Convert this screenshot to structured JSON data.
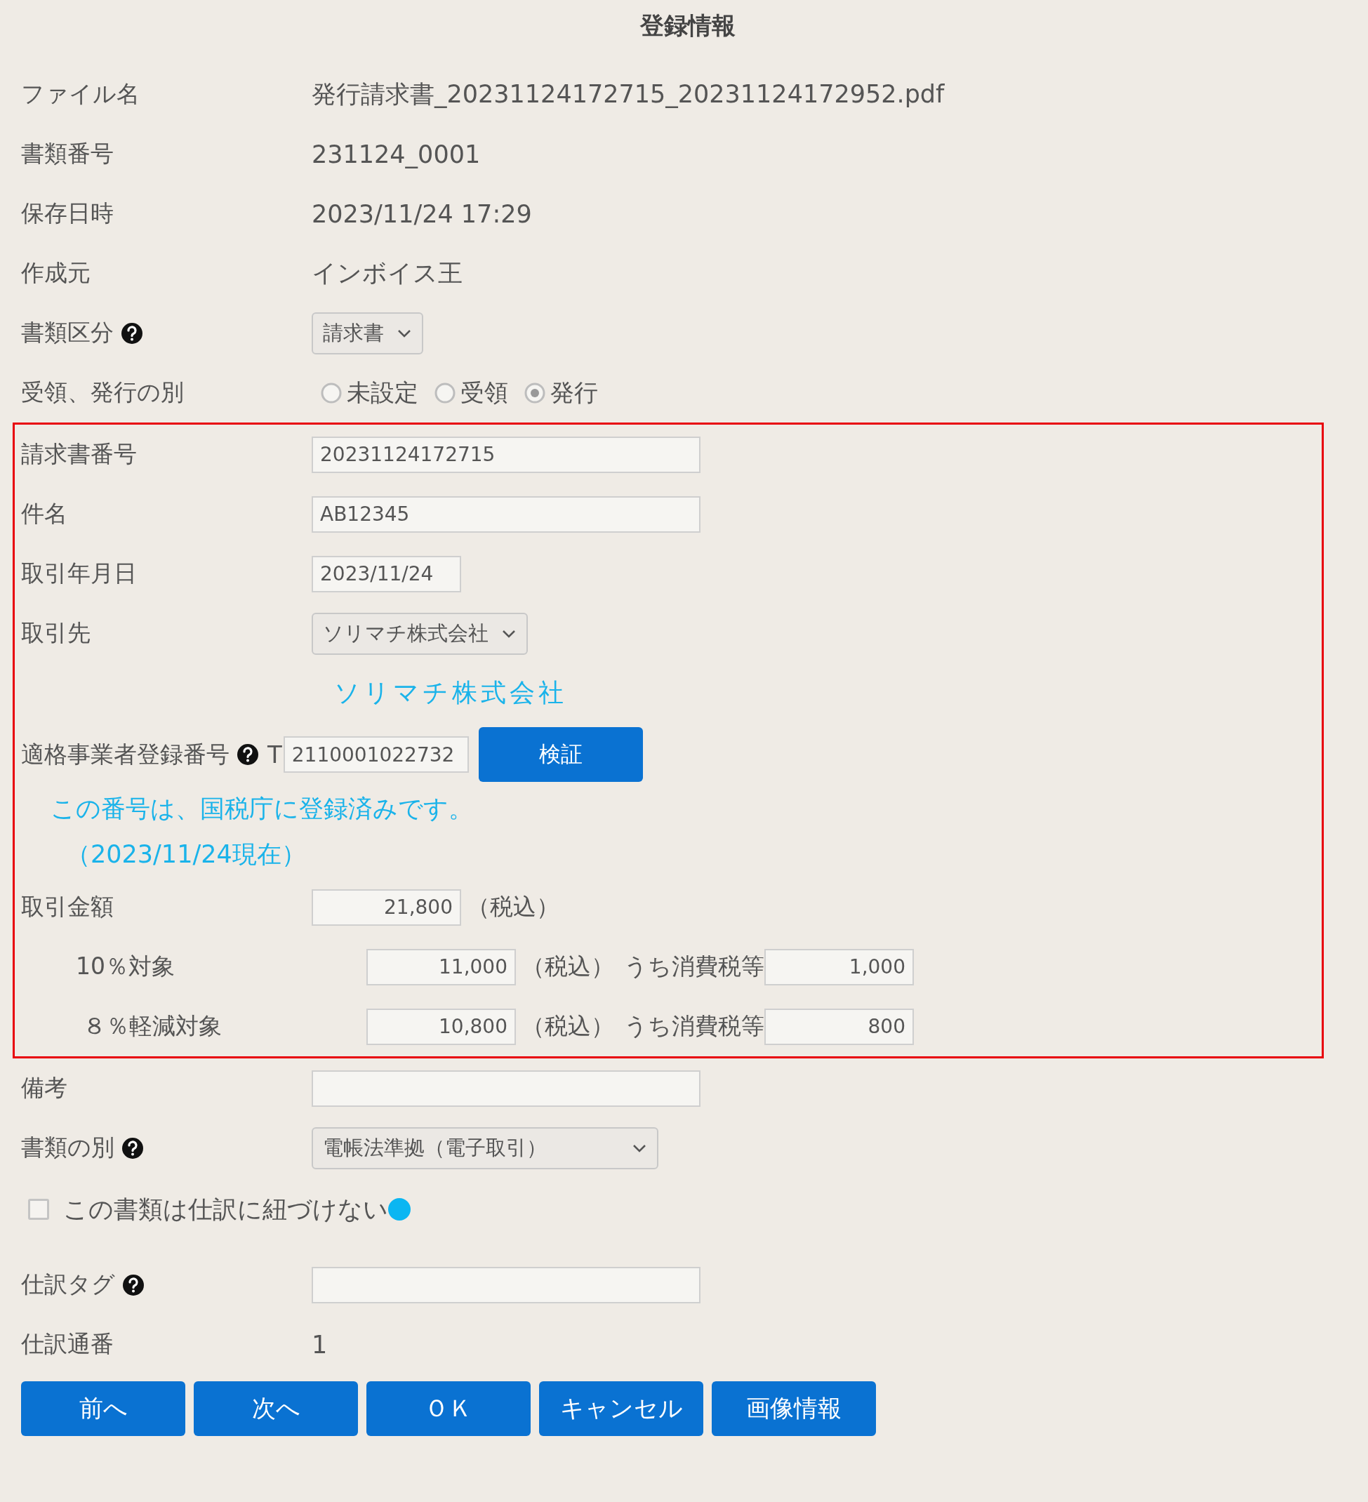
{
  "title": "登録情報",
  "fields": [
    {
      "kind": "text",
      "label": "ファイル名",
      "value": "発行請求書_20231124172715_20231124172952.pdf"
    },
    {
      "kind": "text",
      "label": "書類番号",
      "value": "231124_0001"
    },
    {
      "kind": "text",
      "label": "保存日時",
      "value": "2023/11/24 17:29"
    },
    {
      "kind": "text",
      "label": "作成元",
      "value": "インボイス王"
    },
    {
      "kind": "select",
      "label": "書類区分",
      "help": true,
      "value": "請求書"
    },
    {
      "kind": "radio",
      "label": "受領、発行の別",
      "options": [
        {
          "label": "未設定",
          "selected": false
        },
        {
          "label": "受領",
          "selected": false
        },
        {
          "label": "発行",
          "selected": true
        }
      ]
    }
  ],
  "highlighted_fields": [
    {
      "kind": "input",
      "label": "請求書番号",
      "value": "20231124172715"
    },
    {
      "kind": "input",
      "label": "件名",
      "value": "AB12345"
    },
    {
      "kind": "date",
      "label": "取引年月日",
      "value": "2023/11/24"
    },
    {
      "kind": "select",
      "label": "取引先",
      "value": "ソリマチ株式会社"
    },
    {
      "kind": "link",
      "value": "ソリマチ株式会社"
    },
    {
      "kind": "registration",
      "label": "適格事業者登録番号",
      "help": true,
      "prefix": "T",
      "value": "2110001022732",
      "button": "検証"
    },
    {
      "kind": "notice",
      "lines": [
        "この番号は、国税庁に登録済みです。",
        "（2023/11/24現在）"
      ]
    },
    {
      "kind": "amount",
      "label": "取引金額",
      "value": "21,800",
      "note": "（税込）"
    },
    {
      "kind": "tax",
      "label": "10％対象",
      "value": "11,000",
      "note": "（税込）",
      "tax_label": "うち消費税等",
      "tax_value": "1,000"
    },
    {
      "kind": "tax",
      "label": "８％軽減対象",
      "value": "10,800",
      "note": "（税込）",
      "tax_label": "うち消費税等",
      "tax_value": "800"
    }
  ],
  "more_fields": [
    {
      "kind": "input",
      "label": "備考"
    },
    {
      "kind": "select",
      "label": "書類の別",
      "help": true,
      "wide": true,
      "value": "電帳法準拠（電子取引）"
    },
    {
      "kind": "checkbox",
      "label": "この書類は仕訳に紐づけない",
      "checked": false
    },
    {
      "kind": "input",
      "label": "仕訳タグ",
      "help": true
    },
    {
      "kind": "text",
      "label": "仕訳通番",
      "value": "1"
    }
  ],
  "buttons": [
    "前へ",
    "次へ",
    "ＯＫ",
    "キャンセル",
    "画像情報"
  ]
}
